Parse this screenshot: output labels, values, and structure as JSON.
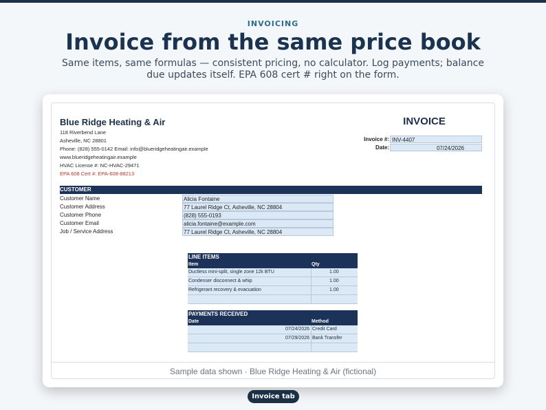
{
  "eyebrow": "INVOICING",
  "headline": "Invoice from the same price book",
  "subhead": "Same items, same formulas — consistent pricing, no calculator. Log payments; balance due updates itself. EPA 608 cert # right on the form.",
  "company": {
    "name": "Blue Ridge Heating & Air",
    "address1": "118 Riverbend Lane",
    "address2": "Asheville, NC 28801",
    "phone_email": "Phone: (828) 555-0142   Email: info@blueridgeheatingair.example",
    "website": "www.blueridgeheatingair.example",
    "hvac_license": "HVAC License #: NC-HVAC-29471",
    "epa_cert": "EPA 608 Cert #: EPA-608-88213"
  },
  "invoice": {
    "title": "INVOICE",
    "number_label": "Invoice #:",
    "number": "INV-4407",
    "date_label": "Date:",
    "date": "07/24/2026"
  },
  "customer": {
    "section_title": "CUSTOMER",
    "rows": [
      {
        "label": "Customer Name",
        "value": "Alicia Fontaine"
      },
      {
        "label": "Customer Address",
        "value": "77 Laurel Ridge Ct, Asheville, NC 28804"
      },
      {
        "label": "Customer Phone",
        "value": "(828) 555-0193"
      },
      {
        "label": "Customer Email",
        "value": "alicia.fontaine@example.com"
      },
      {
        "label": "Job / Service Address",
        "value": "77 Laurel Ridge Ct, Asheville, NC 28804"
      }
    ]
  },
  "line_items": {
    "title": "LINE ITEMS",
    "col_item": "Item",
    "col_qty": "Qty",
    "rows": [
      {
        "item": "Ductless mini-split, single zone 12k BTU",
        "qty": "1.00"
      },
      {
        "item": "Condenser disconnect & whip",
        "qty": "1.00"
      },
      {
        "item": "Refrigerant recovery & evacuation",
        "qty": "1.00"
      },
      {
        "item": "",
        "qty": ""
      }
    ]
  },
  "payments": {
    "title": "PAYMENTS RECEIVED",
    "col_date": "Date",
    "col_method": "Method",
    "rows": [
      {
        "date": "07/24/2026",
        "method": "Credit Card"
      },
      {
        "date": "07/29/2026",
        "method": "Bank Transfer"
      },
      {
        "date": "",
        "method": ""
      }
    ]
  },
  "footer": "Sample data shown · Blue Ridge Heating & Air (fictional)",
  "tab_pill": "Invoice tab"
}
